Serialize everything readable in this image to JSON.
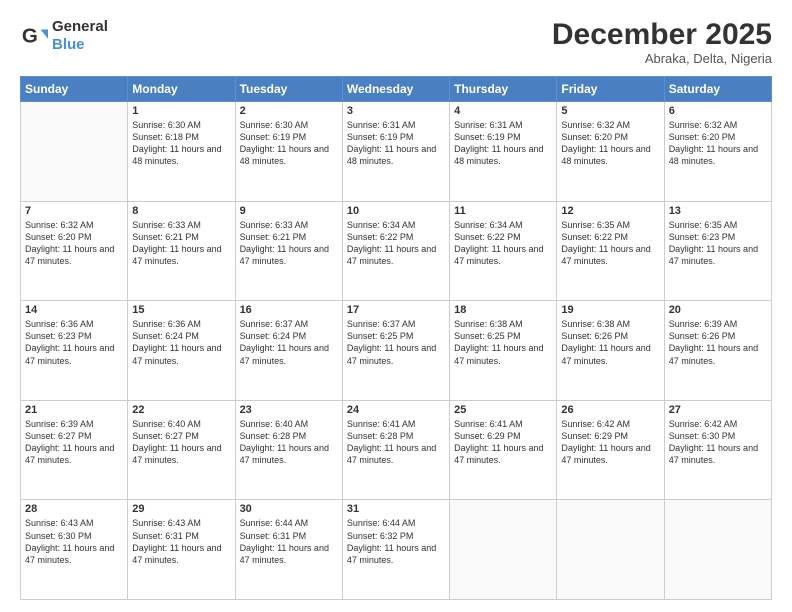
{
  "header": {
    "logo_general": "General",
    "logo_blue": "Blue",
    "month_title": "December 2025",
    "location": "Abraka, Delta, Nigeria"
  },
  "weekdays": [
    "Sunday",
    "Monday",
    "Tuesday",
    "Wednesday",
    "Thursday",
    "Friday",
    "Saturday"
  ],
  "weeks": [
    [
      {
        "day": "",
        "sunrise": "",
        "sunset": "",
        "daylight": ""
      },
      {
        "day": "1",
        "sunrise": "Sunrise: 6:30 AM",
        "sunset": "Sunset: 6:18 PM",
        "daylight": "Daylight: 11 hours and 48 minutes."
      },
      {
        "day": "2",
        "sunrise": "Sunrise: 6:30 AM",
        "sunset": "Sunset: 6:19 PM",
        "daylight": "Daylight: 11 hours and 48 minutes."
      },
      {
        "day": "3",
        "sunrise": "Sunrise: 6:31 AM",
        "sunset": "Sunset: 6:19 PM",
        "daylight": "Daylight: 11 hours and 48 minutes."
      },
      {
        "day": "4",
        "sunrise": "Sunrise: 6:31 AM",
        "sunset": "Sunset: 6:19 PM",
        "daylight": "Daylight: 11 hours and 48 minutes."
      },
      {
        "day": "5",
        "sunrise": "Sunrise: 6:32 AM",
        "sunset": "Sunset: 6:20 PM",
        "daylight": "Daylight: 11 hours and 48 minutes."
      },
      {
        "day": "6",
        "sunrise": "Sunrise: 6:32 AM",
        "sunset": "Sunset: 6:20 PM",
        "daylight": "Daylight: 11 hours and 48 minutes."
      }
    ],
    [
      {
        "day": "7",
        "sunrise": "Sunrise: 6:32 AM",
        "sunset": "Sunset: 6:20 PM",
        "daylight": "Daylight: 11 hours and 47 minutes."
      },
      {
        "day": "8",
        "sunrise": "Sunrise: 6:33 AM",
        "sunset": "Sunset: 6:21 PM",
        "daylight": "Daylight: 11 hours and 47 minutes."
      },
      {
        "day": "9",
        "sunrise": "Sunrise: 6:33 AM",
        "sunset": "Sunset: 6:21 PM",
        "daylight": "Daylight: 11 hours and 47 minutes."
      },
      {
        "day": "10",
        "sunrise": "Sunrise: 6:34 AM",
        "sunset": "Sunset: 6:22 PM",
        "daylight": "Daylight: 11 hours and 47 minutes."
      },
      {
        "day": "11",
        "sunrise": "Sunrise: 6:34 AM",
        "sunset": "Sunset: 6:22 PM",
        "daylight": "Daylight: 11 hours and 47 minutes."
      },
      {
        "day": "12",
        "sunrise": "Sunrise: 6:35 AM",
        "sunset": "Sunset: 6:22 PM",
        "daylight": "Daylight: 11 hours and 47 minutes."
      },
      {
        "day": "13",
        "sunrise": "Sunrise: 6:35 AM",
        "sunset": "Sunset: 6:23 PM",
        "daylight": "Daylight: 11 hours and 47 minutes."
      }
    ],
    [
      {
        "day": "14",
        "sunrise": "Sunrise: 6:36 AM",
        "sunset": "Sunset: 6:23 PM",
        "daylight": "Daylight: 11 hours and 47 minutes."
      },
      {
        "day": "15",
        "sunrise": "Sunrise: 6:36 AM",
        "sunset": "Sunset: 6:24 PM",
        "daylight": "Daylight: 11 hours and 47 minutes."
      },
      {
        "day": "16",
        "sunrise": "Sunrise: 6:37 AM",
        "sunset": "Sunset: 6:24 PM",
        "daylight": "Daylight: 11 hours and 47 minutes."
      },
      {
        "day": "17",
        "sunrise": "Sunrise: 6:37 AM",
        "sunset": "Sunset: 6:25 PM",
        "daylight": "Daylight: 11 hours and 47 minutes."
      },
      {
        "day": "18",
        "sunrise": "Sunrise: 6:38 AM",
        "sunset": "Sunset: 6:25 PM",
        "daylight": "Daylight: 11 hours and 47 minutes."
      },
      {
        "day": "19",
        "sunrise": "Sunrise: 6:38 AM",
        "sunset": "Sunset: 6:26 PM",
        "daylight": "Daylight: 11 hours and 47 minutes."
      },
      {
        "day": "20",
        "sunrise": "Sunrise: 6:39 AM",
        "sunset": "Sunset: 6:26 PM",
        "daylight": "Daylight: 11 hours and 47 minutes."
      }
    ],
    [
      {
        "day": "21",
        "sunrise": "Sunrise: 6:39 AM",
        "sunset": "Sunset: 6:27 PM",
        "daylight": "Daylight: 11 hours and 47 minutes."
      },
      {
        "day": "22",
        "sunrise": "Sunrise: 6:40 AM",
        "sunset": "Sunset: 6:27 PM",
        "daylight": "Daylight: 11 hours and 47 minutes."
      },
      {
        "day": "23",
        "sunrise": "Sunrise: 6:40 AM",
        "sunset": "Sunset: 6:28 PM",
        "daylight": "Daylight: 11 hours and 47 minutes."
      },
      {
        "day": "24",
        "sunrise": "Sunrise: 6:41 AM",
        "sunset": "Sunset: 6:28 PM",
        "daylight": "Daylight: 11 hours and 47 minutes."
      },
      {
        "day": "25",
        "sunrise": "Sunrise: 6:41 AM",
        "sunset": "Sunset: 6:29 PM",
        "daylight": "Daylight: 11 hours and 47 minutes."
      },
      {
        "day": "26",
        "sunrise": "Sunrise: 6:42 AM",
        "sunset": "Sunset: 6:29 PM",
        "daylight": "Daylight: 11 hours and 47 minutes."
      },
      {
        "day": "27",
        "sunrise": "Sunrise: 6:42 AM",
        "sunset": "Sunset: 6:30 PM",
        "daylight": "Daylight: 11 hours and 47 minutes."
      }
    ],
    [
      {
        "day": "28",
        "sunrise": "Sunrise: 6:43 AM",
        "sunset": "Sunset: 6:30 PM",
        "daylight": "Daylight: 11 hours and 47 minutes."
      },
      {
        "day": "29",
        "sunrise": "Sunrise: 6:43 AM",
        "sunset": "Sunset: 6:31 PM",
        "daylight": "Daylight: 11 hours and 47 minutes."
      },
      {
        "day": "30",
        "sunrise": "Sunrise: 6:44 AM",
        "sunset": "Sunset: 6:31 PM",
        "daylight": "Daylight: 11 hours and 47 minutes."
      },
      {
        "day": "31",
        "sunrise": "Sunrise: 6:44 AM",
        "sunset": "Sunset: 6:32 PM",
        "daylight": "Daylight: 11 hours and 47 minutes."
      },
      {
        "day": "",
        "sunrise": "",
        "sunset": "",
        "daylight": ""
      },
      {
        "day": "",
        "sunrise": "",
        "sunset": "",
        "daylight": ""
      },
      {
        "day": "",
        "sunrise": "",
        "sunset": "",
        "daylight": ""
      }
    ]
  ]
}
